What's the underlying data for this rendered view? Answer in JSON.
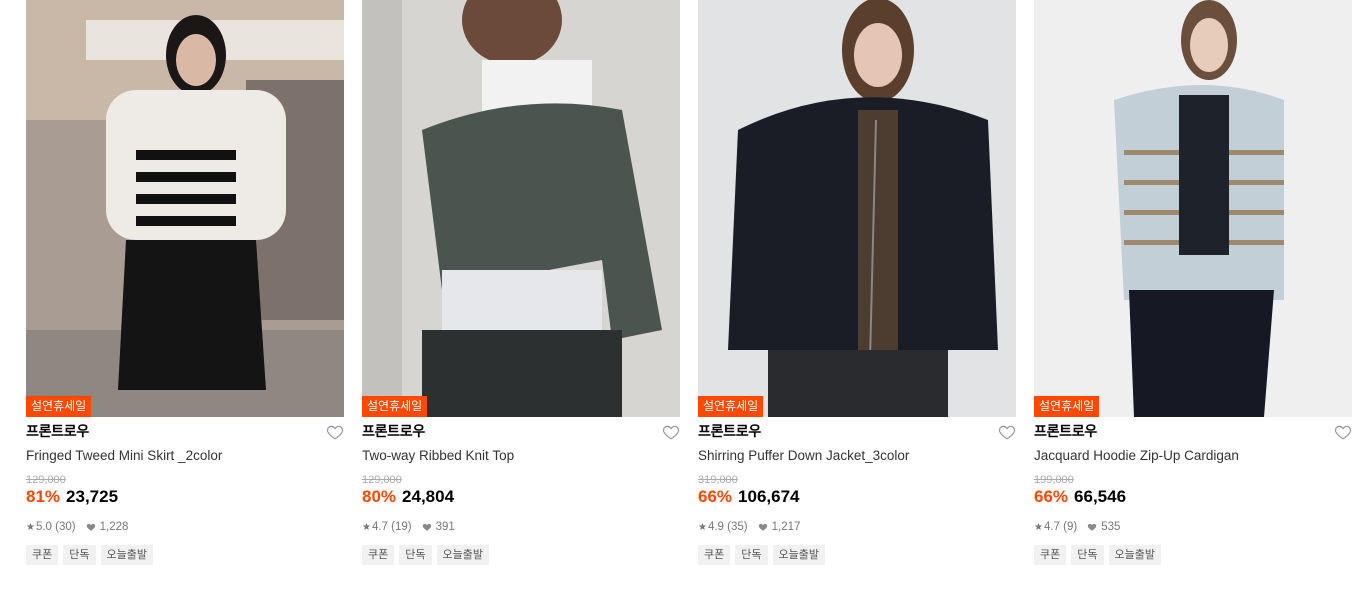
{
  "products": [
    {
      "badge": "설연휴세일",
      "brand": "프론트로우",
      "name": "Fringed Tweed Mini Skirt _2color",
      "original_price": "129,000",
      "discount": "81%",
      "price": "23,725",
      "rating": "5.0",
      "reviews": "(30)",
      "likes": "1,228",
      "tags": [
        "쿠폰",
        "단독",
        "오늘출발"
      ]
    },
    {
      "badge": "설연휴세일",
      "brand": "프론트로우",
      "name": "Two-way Ribbed Knit Top",
      "original_price": "129,000",
      "discount": "80%",
      "price": "24,804",
      "rating": "4.7",
      "reviews": "(19)",
      "likes": "391",
      "tags": [
        "쿠폰",
        "단독",
        "오늘출발"
      ]
    },
    {
      "badge": "설연휴세일",
      "brand": "프론트로우",
      "name": "Shirring Puffer Down Jacket_3color",
      "original_price": "319,000",
      "discount": "66%",
      "price": "106,674",
      "rating": "4.9",
      "reviews": "(35)",
      "likes": "1,217",
      "tags": [
        "쿠폰",
        "단독",
        "오늘출발"
      ]
    },
    {
      "badge": "설연휴세일",
      "brand": "프론트로우",
      "name": "Jacquard Hoodie Zip-Up Cardigan",
      "original_price": "199,000",
      "discount": "66%",
      "price": "66,546",
      "rating": "4.7",
      "reviews": "(9)",
      "likes": "535",
      "tags": [
        "쿠폰",
        "단독",
        "오늘출발"
      ]
    }
  ],
  "colors": {
    "accent": "#ff4800",
    "tag_bg": "#f1f1f1"
  },
  "icons": {
    "wishlist": "heart-outline-icon",
    "rating": "star-icon",
    "likes": "heart-filled-icon"
  }
}
